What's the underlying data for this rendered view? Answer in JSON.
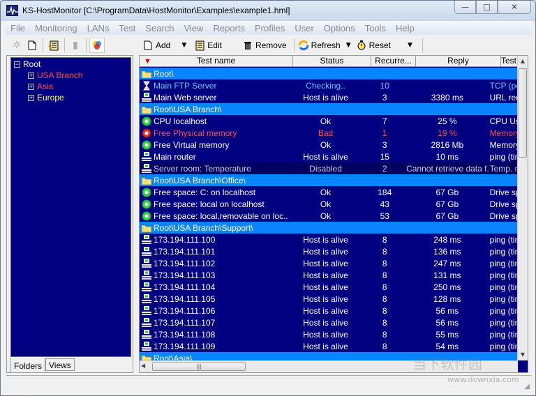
{
  "window": {
    "title": "KS-HostMonitor  [C:\\ProgramData\\HostMonitor\\Examples\\example1.hml]",
    "controls": {
      "minimize": "—",
      "maximize": "□",
      "close": "✕"
    }
  },
  "menu": [
    "File",
    "Monitoring",
    "LANs",
    "Test",
    "Search",
    "View",
    "Reports",
    "Profiles",
    "User",
    "Options",
    "Tools",
    "Help"
  ],
  "toolbar_left": {
    "icons": [
      "new-folder-icon",
      "new-file-icon",
      "edit-folder-icon",
      "delete-folder-icon",
      "color-icon"
    ]
  },
  "toolbar_right": {
    "add": "Add",
    "edit": "Edit",
    "remove": "Remove",
    "refresh": "Refresh",
    "reset": "Reset"
  },
  "tree": {
    "root": "Root",
    "children": [
      {
        "label": "USA Branch",
        "color": "#ff4a4a"
      },
      {
        "label": "Asia",
        "color": "#ff4a4a"
      },
      {
        "label": "Europe",
        "color": "#ffff60"
      }
    ]
  },
  "left_tabs": [
    "Folders",
    "Views"
  ],
  "grid": {
    "columns": [
      "Test name",
      "Status",
      "Recurre...",
      "Reply",
      "Test me"
    ],
    "rows": [
      {
        "type": "group",
        "name": "Root\\"
      },
      {
        "type": "item",
        "icon": "hourglass-icon",
        "name": "Main FTP Server",
        "status": "Checking..",
        "rec": "10",
        "reply": "",
        "method": "TCP (po",
        "color": "#5cc8ff"
      },
      {
        "type": "item",
        "icon": "host-icon",
        "name": "Main Web server",
        "status": "Host is alive",
        "rec": "3",
        "reply": "3380 ms",
        "method": "URL req",
        "color": "#ffffff"
      },
      {
        "type": "group",
        "name": "Root\\USA Branch\\"
      },
      {
        "type": "item",
        "icon": "gear-ok-icon",
        "name": "CPU localhost",
        "status": "Ok",
        "rec": "7",
        "reply": "25 %",
        "method": "CPU Us",
        "color": "#ffffff"
      },
      {
        "type": "item",
        "icon": "gear-bad-icon",
        "name": "Free Physical memory",
        "status": "Bad",
        "rec": "1",
        "reply": "19 %",
        "method": "Memory",
        "color": "#ff4a4a"
      },
      {
        "type": "item",
        "icon": "gear-ok-icon",
        "name": "Free Virtual memory",
        "status": "Ok",
        "rec": "3",
        "reply": "2816 Mb",
        "method": "Memory",
        "color": "#ffffff"
      },
      {
        "type": "item",
        "icon": "host-icon",
        "name": "Main router",
        "status": "Host is alive",
        "rec": "15",
        "reply": "10 ms",
        "method": "ping (tim",
        "color": "#ffffff"
      },
      {
        "type": "dim",
        "icon": "host-icon",
        "name": "Server room: Temperature",
        "status": "Disabled",
        "rec": "2",
        "reply": "Cannot retrieve data f...",
        "method": "Temp. m",
        "color": "#c8c8e8"
      },
      {
        "type": "group",
        "name": "Root\\USA Branch\\Office\\"
      },
      {
        "type": "item",
        "icon": "gear-ok-icon",
        "name": "Free space: C: on localhost",
        "status": "Ok",
        "rec": "184",
        "reply": "67 Gb",
        "method": "Drive sp",
        "color": "#ffffff"
      },
      {
        "type": "item",
        "icon": "gear-ok-icon",
        "name": "Free space: local on localhost",
        "status": "Ok",
        "rec": "43",
        "reply": "67 Gb",
        "method": "Drive sp",
        "color": "#ffffff"
      },
      {
        "type": "item",
        "icon": "gear-ok-icon",
        "name": "Free space: local,removable on loc...",
        "status": "Ok",
        "rec": "53",
        "reply": "67 Gb",
        "method": "Drive sp",
        "color": "#ffffff"
      },
      {
        "type": "group",
        "name": "Root\\USA Branch\\Support\\"
      },
      {
        "type": "item",
        "icon": "host-icon",
        "name": "173.194.111.100",
        "status": "Host is alive",
        "rec": "8",
        "reply": "248 ms",
        "method": "ping (tim",
        "color": "#ffffff"
      },
      {
        "type": "item",
        "icon": "host-icon",
        "name": "173.194.111.101",
        "status": "Host is alive",
        "rec": "8",
        "reply": "136 ms",
        "method": "ping (tim",
        "color": "#ffffff"
      },
      {
        "type": "item",
        "icon": "host-icon",
        "name": "173.194.111.102",
        "status": "Host is alive",
        "rec": "8",
        "reply": "247 ms",
        "method": "ping (tim",
        "color": "#ffffff"
      },
      {
        "type": "item",
        "icon": "host-icon",
        "name": "173.194.111.103",
        "status": "Host is alive",
        "rec": "8",
        "reply": "131 ms",
        "method": "ping (tim",
        "color": "#ffffff"
      },
      {
        "type": "item",
        "icon": "host-icon",
        "name": "173.194.111.104",
        "status": "Host is alive",
        "rec": "8",
        "reply": "250 ms",
        "method": "ping (tim",
        "color": "#ffffff"
      },
      {
        "type": "item",
        "icon": "host-icon",
        "name": "173.194.111.105",
        "status": "Host is alive",
        "rec": "8",
        "reply": "128 ms",
        "method": "ping (tim",
        "color": "#ffffff"
      },
      {
        "type": "item",
        "icon": "host-icon",
        "name": "173.194.111.106",
        "status": "Host is alive",
        "rec": "8",
        "reply": "56 ms",
        "method": "ping (tim",
        "color": "#ffffff"
      },
      {
        "type": "item",
        "icon": "host-icon",
        "name": "173.194.111.107",
        "status": "Host is alive",
        "rec": "8",
        "reply": "56 ms",
        "method": "ping (tim",
        "color": "#ffffff"
      },
      {
        "type": "item",
        "icon": "host-icon",
        "name": "173.194.111.108",
        "status": "Host is alive",
        "rec": "8",
        "reply": "55 ms",
        "method": "ping (tim",
        "color": "#ffffff"
      },
      {
        "type": "item",
        "icon": "host-icon",
        "name": "173.194.111.109",
        "status": "Host is alive",
        "rec": "8",
        "reply": "54 ms",
        "method": "ping (tim",
        "color": "#ffffff"
      },
      {
        "type": "group",
        "name": "Root\\Asia\\"
      }
    ]
  },
  "watermark": {
    "text": "当下软件园",
    "url_text": "www.downxia.com"
  }
}
